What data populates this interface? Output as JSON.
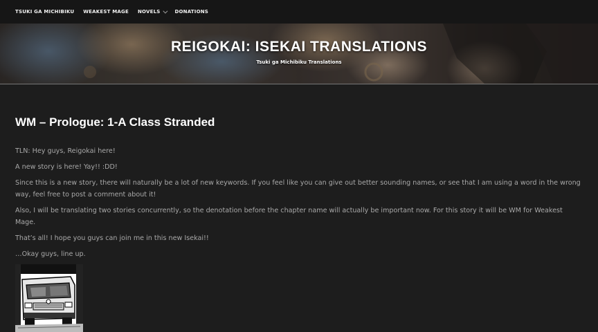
{
  "nav": {
    "items": [
      {
        "label": "TSUKI GA MICHIBIKU",
        "has_dropdown": false
      },
      {
        "label": "WEAKEST MAGE",
        "has_dropdown": false
      },
      {
        "label": "NOVELS",
        "has_dropdown": true
      },
      {
        "label": "DONATIONS",
        "has_dropdown": false
      }
    ],
    "dropdown_icon": "chevron-down-icon"
  },
  "header": {
    "site_title": "REIGOKAI: ISEKAI TRANSLATIONS",
    "tagline": "Tsuki ga Michibiku Translations"
  },
  "post": {
    "title": "WM – Prologue: 1-A Class Stranded",
    "paragraphs": [
      "TLN: Hey guys, Reigokai here!",
      "A new story is here! Yay!! :DD!",
      "Since this is a new story, there will naturally be a lot of new keywords. If you feel like you can give out better sounding names, or see that I am using a word in the wrong way, feel free to post a comment about it!",
      "Also, I will be translating two stories concurrently, so the denotation before the chapter name will actually be important now. For this story it will be WM for Weakest Mage.",
      "That’s all! I hope you guys can join me in this new Isekai!!",
      "…Okay guys, line up."
    ],
    "image_subject": "manga-truck-illustration"
  },
  "colors": {
    "page_background": "#1d1d1d",
    "nav_background": "#161616",
    "title_text": "#ffffff",
    "body_text": "#a9a9a9"
  }
}
